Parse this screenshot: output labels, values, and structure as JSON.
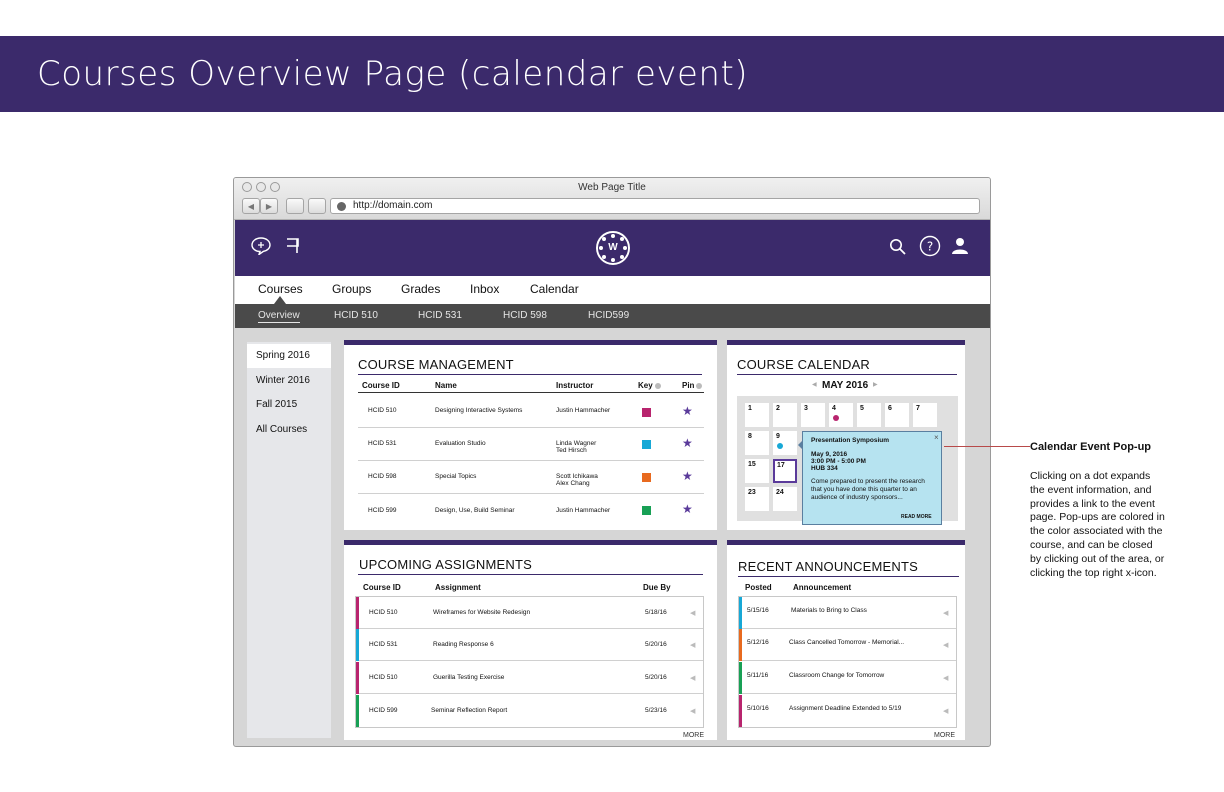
{
  "header": {
    "title": "Courses Overview Page (calendar event)"
  },
  "browser": {
    "window_title": "Web Page Title",
    "url": "http://domain.com"
  },
  "main_nav": {
    "items": [
      "Courses",
      "Groups",
      "Grades",
      "Inbox",
      "Calendar"
    ],
    "active": "Courses"
  },
  "sub_nav": {
    "items": [
      "Overview",
      "HCID 510",
      "HCID 531",
      "HCID 598",
      "HCID599"
    ],
    "active": "Overview"
  },
  "sidebar": {
    "items": [
      "Spring 2016",
      "Winter 2016",
      "Fall 2015",
      "All Courses"
    ],
    "active": "Spring 2016"
  },
  "course_management": {
    "title": "COURSE MANAGEMENT",
    "columns": [
      "Course ID",
      "Name",
      "Instructor",
      "Key",
      "Pin"
    ],
    "rows": [
      {
        "id": "HCID 510",
        "name": "Designing Interactive Systems",
        "instructor": "Justin Hammacher",
        "instructor2": "",
        "color": "#b8246e"
      },
      {
        "id": "HCID 531",
        "name": "Evaluation Studio",
        "instructor": "Linda Wagner",
        "instructor2": "Ted Hirsch",
        "color": "#17a8d6"
      },
      {
        "id": "HCID 598",
        "name": "Special Topics",
        "instructor": "Scott Ichikawa",
        "instructor2": "Alex Chang",
        "color": "#e86a1f"
      },
      {
        "id": "HCID 599",
        "name": "Design, Use, Build Seminar",
        "instructor": "Justin Hammacher",
        "instructor2": "",
        "color": "#18a055"
      }
    ]
  },
  "course_calendar": {
    "title": "COURSE CALENDAR",
    "month": "MAY 2016",
    "days": [
      "1",
      "2",
      "3",
      "4",
      "5",
      "6",
      "7",
      "8",
      "9",
      "15",
      "17",
      "23",
      "24"
    ],
    "popup": {
      "title": "Presentation Symposium",
      "date": "May 9, 2016",
      "time": "3:00 PM - 5:00 PM",
      "location": "HUB 334",
      "body1": "Come prepared to present the research",
      "body2": "that you have done this quarter to an",
      "body3": "audience of industry sponsors...",
      "read_more": "READ MORE",
      "close": "×"
    }
  },
  "upcoming_assignments": {
    "title": "UPCOMING ASSIGNMENTS",
    "columns": [
      "Course ID",
      "Assignment",
      "Due By"
    ],
    "rows": [
      {
        "id": "HCID 510",
        "assignment": "Wireframes for Website Redesign",
        "due": "5/18/16",
        "color": "#b8246e"
      },
      {
        "id": "HCID 531",
        "assignment": "Reading Response 6",
        "due": "5/20/16",
        "color": "#17a8d6"
      },
      {
        "id": "HCID 510",
        "assignment": "Guerilla Testing Exercise",
        "due": "5/20/16",
        "color": "#b8246e"
      },
      {
        "id": "HCID 599",
        "assignment": "Seminar Reflection Report",
        "due": "5/23/16",
        "color": "#18a055"
      }
    ],
    "more": "MORE"
  },
  "recent_announcements": {
    "title": "RECENT ANNOUNCEMENTS",
    "columns": [
      "Posted",
      "Announcement"
    ],
    "rows": [
      {
        "posted": "5/15/16",
        "text": "Materials to Bring to Class",
        "color": "#17a8d6"
      },
      {
        "posted": "5/12/16",
        "text": "Class Cancelled Tomorrow - Memorial...",
        "color": "#e86a1f"
      },
      {
        "posted": "5/11/16",
        "text": "Classroom Change for Tomorrow",
        "color": "#18a055"
      },
      {
        "posted": "5/10/16",
        "text": "Assignment Deadline Extended to 5/19",
        "color": "#b8246e"
      }
    ],
    "more": "MORE"
  },
  "annotation": {
    "title": "Calendar Event Pop-up",
    "lines": [
      "Clicking on a dot expands",
      "the event information, and",
      "provides a link to the event",
      "page. Pop-ups are colored in",
      "the color associated with the",
      "course, and can be closed",
      "by clicking out of the area, or",
      "clicking the top right x-icon."
    ]
  },
  "colors": {
    "brand": "#3b2a6b",
    "subnav": "#4a4a4a"
  }
}
